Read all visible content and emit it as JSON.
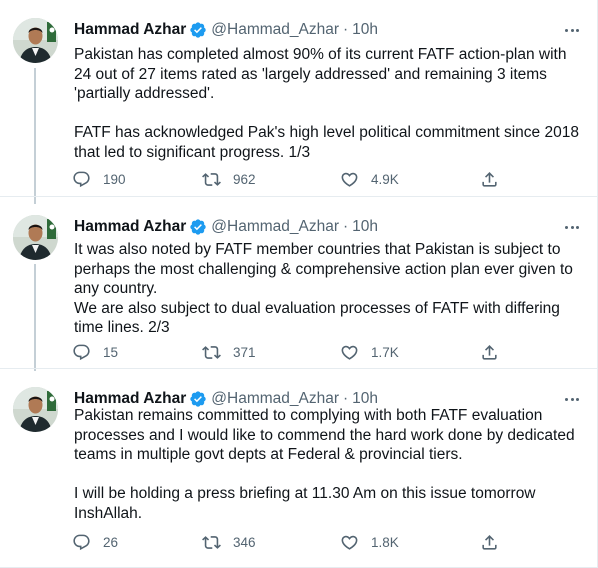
{
  "tweets": [
    {
      "name": "Hammad Azhar",
      "handle": "@Hammad_Azhar",
      "separator": "·",
      "time": "10h",
      "paragraphs": [
        "Pakistan has completed almost 90% of its current FATF action-plan with\n24 out of 27 items rated as 'largely addressed' and remaining 3 items\n'partially addressed'.",
        "FATF has acknowledged Pak's high level political commitment since 2018\nthat led to significant  progress. 1/3"
      ],
      "replies": "190",
      "retweets": "962",
      "likes": "4.9K"
    },
    {
      "name": "Hammad Azhar",
      "handle": "@Hammad_Azhar",
      "separator": "·",
      "time": "10h",
      "paragraphs": [
        "It was also noted by FATF member countries that Pakistan is subject to\nperhaps the most challenging & comprehensive action plan ever given to\nany country.\nWe are also subject to dual evaluation processes of FATF with differing\ntime lines. 2/3"
      ],
      "replies": "15",
      "retweets": "371",
      "likes": "1.7K"
    },
    {
      "name": "Hammad Azhar",
      "handle": "@Hammad_Azhar",
      "separator": "·",
      "time": "10h",
      "paragraphs": [
        "Pakistan remains committed to complying with both FATF evaluation\nprocesses and I would like to commend the hard work done by dedicated\nteams in multiple govt depts at Federal & provincial tiers.",
        "I will be holding a press briefing at 11.30 Am on this issue tomorrow\nInshAllah."
      ],
      "replies": "26",
      "retweets": "346",
      "likes": "1.8K"
    }
  ],
  "icons": {
    "verified": "verified-badge-icon",
    "more": "more-options-icon",
    "reply": "reply-icon",
    "retweet": "retweet-icon",
    "like": "like-heart-icon",
    "share": "share-icon"
  },
  "colors": {
    "verified": "#1d9bf0",
    "secondary_text": "#536471",
    "primary_text": "#0f1419",
    "thread_line": "#c4cfd6",
    "divider": "#e6ecf0"
  }
}
